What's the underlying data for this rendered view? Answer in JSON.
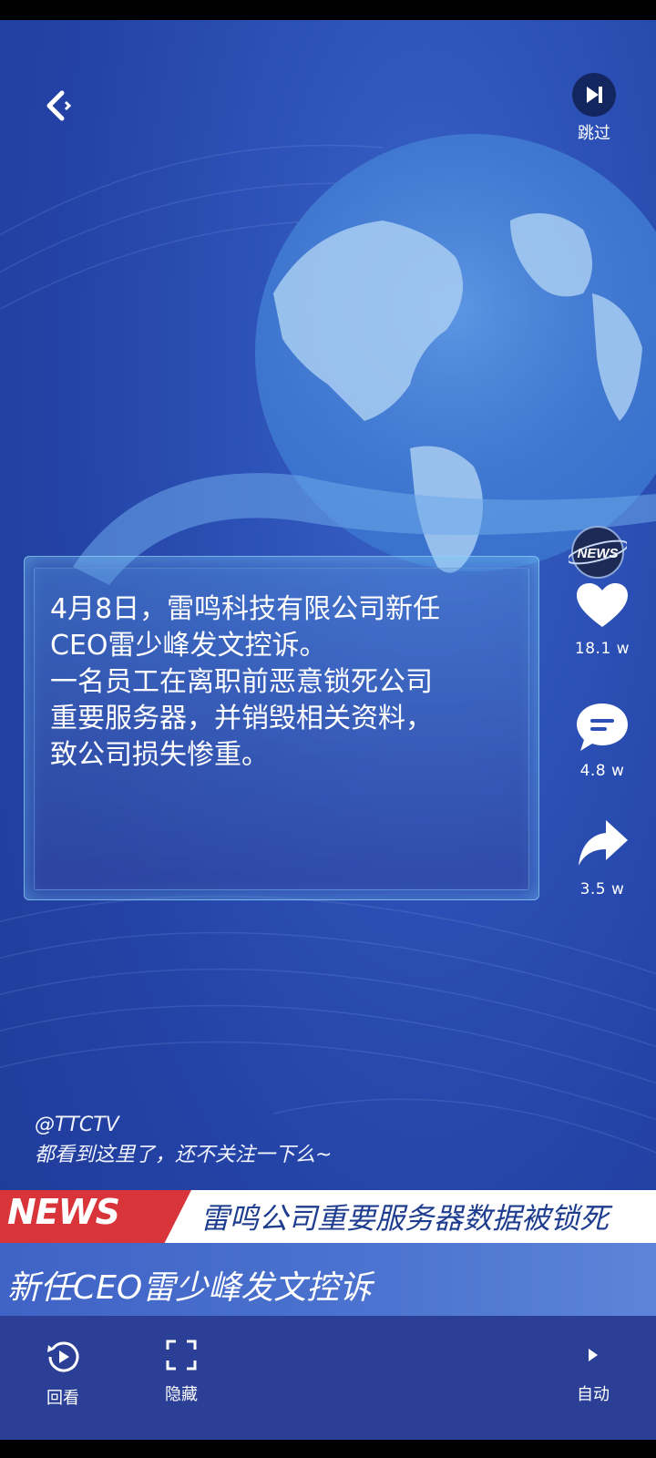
{
  "header": {
    "back_icon": "back-arrow-icon",
    "skip_label": "跳过",
    "skip_icon": "skip-forward-icon"
  },
  "side_actions": {
    "likes": "18.1 w",
    "comments": "4.8 w",
    "shares": "3.5 w",
    "news_logo_text": "NEWS"
  },
  "story": {
    "lines": [
      "4月8日，雷鸣科技有限公司新任",
      "CEO雷少峰发文控诉。",
      "一名员工在离职前恶意锁死公司",
      "重要服务器，并销毁相关资料，",
      "致公司损失惨重。"
    ]
  },
  "caption": {
    "author": "@TTCTV",
    "text": "都看到这里了，还不关注一下么~"
  },
  "ticker": {
    "badge": "NEWS",
    "headline": "雷鸣公司重要服务器数据被锁死",
    "subline": "新任CEO雷少峰发文控诉"
  },
  "controls": {
    "replay_label": "回看",
    "hide_label": "隐藏",
    "auto_label": "自动"
  },
  "colors": {
    "background": "#2b4fb4",
    "ticker_red": "#d8343a",
    "ticker_text": "#1f3d8f",
    "controls_bg": "#2a3f95"
  }
}
